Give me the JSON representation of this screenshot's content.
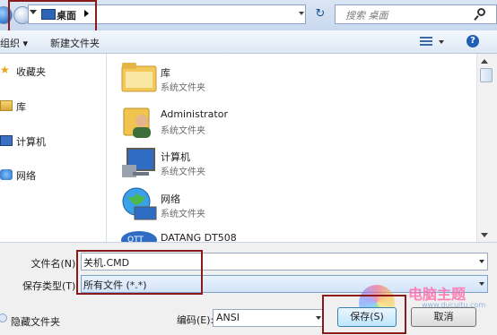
{
  "address_bar": {
    "location": "桌面",
    "search_placeholder": "搜索 桌面"
  },
  "toolbar": {
    "organize": "组织 ▾",
    "new_folder": "新建文件夹"
  },
  "nav": {
    "items": [
      {
        "label": "收藏夹",
        "icon": "star-icon"
      },
      {
        "label": "库",
        "icon": "library-icon"
      },
      {
        "label": "计算机",
        "icon": "computer-icon"
      },
      {
        "label": "网络",
        "icon": "network-icon"
      }
    ]
  },
  "files": [
    {
      "name": "库",
      "sub": "系统文件夹",
      "icon": "library-folder-icon"
    },
    {
      "name": "Administrator",
      "sub": "系统文件夹",
      "icon": "user-icon"
    },
    {
      "name": "计算机",
      "sub": "系统文件夹",
      "icon": "computer-icon"
    },
    {
      "name": "网络",
      "sub": "系统文件夹",
      "icon": "network-globe-icon"
    },
    {
      "name": "DATANG DT508",
      "sub": "",
      "icon": "datang-logo-icon"
    }
  ],
  "form": {
    "filename_label": "文件名(N):",
    "filename_value": "关机.CMD",
    "filetype_label": "保存类型(T):",
    "filetype_value": "所有文件 (*.*)",
    "encoding_label": "编码(E):",
    "encoding_value": "ANSI",
    "hide_folders": "隐藏文件夹",
    "save_label": "保存(S)",
    "cancel_label": "取消"
  },
  "watermark": {
    "text": "电脑主题",
    "url": "www.ducuitu.com"
  },
  "colors": {
    "highlight_box": "#8b1a1a",
    "accent": "#2e64b8"
  }
}
